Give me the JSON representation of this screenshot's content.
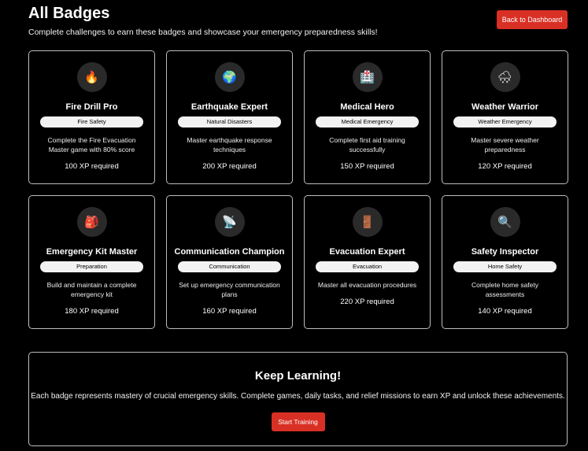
{
  "header": {
    "title": "All Badges",
    "subtitle": "Complete challenges to earn these badges and showcase your emergency preparedness skills!",
    "back_label": "Back to Dashboard"
  },
  "badges": [
    {
      "icon": "🔥",
      "icon_name": "fire-icon",
      "title": "Fire Drill Pro",
      "category": "Fire Safety",
      "description": "Complete the Fire Evacuation Master game with 80% score",
      "xp": "100 XP  required"
    },
    {
      "icon": "🌍",
      "icon_name": "globe-icon",
      "title": "Earthquake Expert",
      "category": "Natural Disasters",
      "description": "Master earthquake response techniques",
      "xp": "200 XP  required"
    },
    {
      "icon": "🏥",
      "icon_name": "hospital-icon",
      "title": "Medical Hero",
      "category": "Medical Emergency",
      "description": "Complete first aid training successfully",
      "xp": "150 XP  required"
    },
    {
      "icon": "🌨",
      "icon_name": "storm-cloud-icon",
      "title": "Weather Warrior",
      "category": "Weather Emergency",
      "description": "Master severe weather preparedness",
      "xp": "120 XP  required"
    },
    {
      "icon": "🎒",
      "icon_name": "backpack-icon",
      "title": "Emergency Kit Master",
      "category": "Preparation",
      "description": "Build and maintain a complete emergency kit",
      "xp": "180 XP  required"
    },
    {
      "icon": "📡",
      "icon_name": "satellite-dish-icon",
      "title": "Communication Champion",
      "category": "Communication",
      "description": "Set up emergency communication plans",
      "xp": "160 XP  required"
    },
    {
      "icon": "🚪",
      "icon_name": "door-icon",
      "title": "Evacuation Expert",
      "category": "Evacuation",
      "description": "Master all evacuation procedures",
      "xp": "220 XP  required"
    },
    {
      "icon": "🔍",
      "icon_name": "magnifier-icon",
      "title": "Safety Inspector",
      "category": "Home Safety",
      "description": "Complete home safety assessments",
      "xp": "140 XP  required"
    }
  ],
  "learn": {
    "title": "Keep Learning!",
    "text": "Each badge represents mastery of crucial emergency skills. Complete games, daily tasks, and relief missions to earn XP and unlock these achievements.",
    "button_label": "Start Training"
  },
  "colors": {
    "accent": "#d93025",
    "background": "#000000",
    "border": "#bdbdbd"
  }
}
